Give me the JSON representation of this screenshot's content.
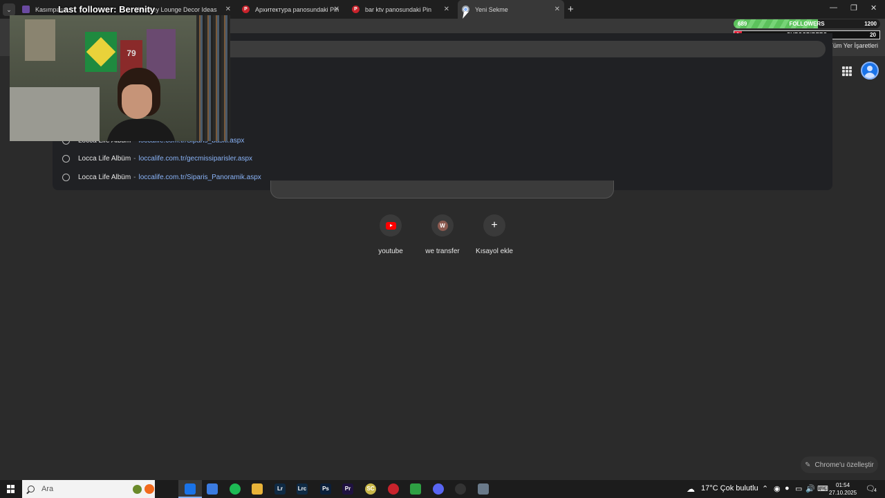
{
  "browser": {
    "tabs": [
      {
        "title": "Kasımpaşa",
        "icon": "app-icon",
        "active": false
      },
      {
        "title": "Whiskey Lounge Decor Ideas S",
        "icon": "pinterest-icon",
        "active": false
      },
      {
        "title": "Архитектура panosundaki Pin",
        "icon": "pinterest-icon",
        "active": false
      },
      {
        "title": "bar ktv panosundaki Pin",
        "icon": "pinterest-icon",
        "active": false
      },
      {
        "title": "Yeni Sekme",
        "icon": "chrome-icon",
        "active": true
      }
    ],
    "new_tab_glyph": "+",
    "all_bookmarks": "Tüm Yer İşaretleri"
  },
  "omnibox": {
    "suggestions": [
      {
        "title": "Locca Life Albüm",
        "sep": "-",
        "url": "loccalife.com.tr/Siparis_baski.aspx"
      },
      {
        "title": "Locca Life Albüm",
        "sep": "-",
        "url": "loccalife.com.tr/gecmissiparisler.aspx"
      },
      {
        "title": "Locca Life Albüm",
        "sep": "-",
        "url": "loccalife.com.tr/Siparis_Panoramik.aspx"
      }
    ]
  },
  "shortcuts": [
    {
      "label": "youtube",
      "icon": "youtube-icon"
    },
    {
      "label": "we transfer",
      "icon": "wetransfer-icon",
      "letter": "W"
    },
    {
      "label": "Kısayol ekle",
      "icon": "add-icon",
      "glyph": "+"
    }
  ],
  "customize": {
    "label": "Chrome'u özelleştir"
  },
  "stream_overlay": {
    "last_follower": "Last follower: Berenity",
    "followers": {
      "label": "FOLLOWERS",
      "current": "689",
      "goal": "1200",
      "progress": 0.574
    },
    "subscribers": {
      "label": "SUBSCRIBERS",
      "current": "1",
      "goal": "20",
      "progress": 0.05
    },
    "poster_text": "79"
  },
  "taskbar": {
    "search_placeholder": "Ara",
    "weather": "17°C  Çok bulutlu",
    "time": "01:54",
    "date": "27.10.2025",
    "notification_count": "4",
    "apps": [
      {
        "name": "task-view-icon",
        "label": "",
        "color": "#1c1c1c"
      },
      {
        "name": "chrome-icon",
        "label": "",
        "color": "#1a73e8"
      },
      {
        "name": "copilot-icon",
        "label": "",
        "color": "#3b7be0"
      },
      {
        "name": "spotify-icon",
        "label": "",
        "color": "#1db954"
      },
      {
        "name": "file-explorer-icon",
        "label": "",
        "color": "#e8b339"
      },
      {
        "name": "lightroom-icon",
        "label": "Lr",
        "color": "#0f2a44"
      },
      {
        "name": "lightroom-classic-icon",
        "label": "Lrc",
        "color": "#0f2a44"
      },
      {
        "name": "photoshop-icon",
        "label": "Ps",
        "color": "#0b1f3a"
      },
      {
        "name": "premiere-icon",
        "label": "Pr",
        "color": "#1f1240"
      },
      {
        "name": "sc-app-icon",
        "label": "SC",
        "color": "#c9b84a"
      },
      {
        "name": "red-app-icon",
        "label": "",
        "color": "#c8232c"
      },
      {
        "name": "green-app-icon",
        "label": "",
        "color": "#2ea043"
      },
      {
        "name": "discord-icon",
        "label": "",
        "color": "#5865f2"
      },
      {
        "name": "obs-icon",
        "label": "",
        "color": "#333333"
      },
      {
        "name": "window-app-icon",
        "label": "",
        "color": "#6a7a8a"
      }
    ]
  },
  "colors": {
    "accent": "#8ab4f8",
    "followers_bar": "#5cc25c",
    "subs_bar": "#e0223a"
  }
}
